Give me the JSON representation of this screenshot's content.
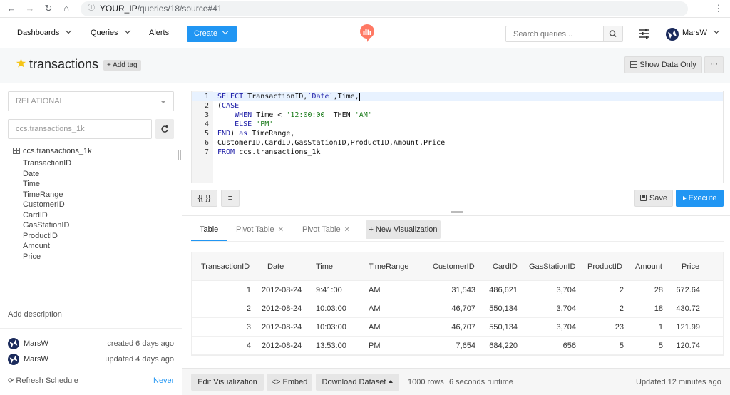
{
  "browser": {
    "url_host": "YOUR_IP",
    "url_path": "/queries/18/source#41"
  },
  "header": {
    "dashboards_label": "Dashboards",
    "queries_label": "Queries",
    "alerts_label": "Alerts",
    "create_label": "Create",
    "search_placeholder": "Search queries...",
    "user_name": "MarsW"
  },
  "query": {
    "title": "transactions",
    "add_tag_label": "+ Add tag",
    "show_data_label": "Show Data Only",
    "more_label": "···"
  },
  "schema": {
    "datasource": "RELATIONAL",
    "search_value": "ccs.transactions_1k",
    "table_name": "ccs.transactions_1k",
    "columns": [
      "TransactionID",
      "Date",
      "Time",
      "TimeRange",
      "CustomerID",
      "CardID",
      "GasStationID",
      "ProductID",
      "Amount",
      "Price"
    ],
    "add_description": "Add description",
    "created_by": "MarsW",
    "created_info": "created 6 days ago",
    "updated_by": "MarsW",
    "updated_info": "updated 4 days ago",
    "refresh_label": "Refresh Schedule",
    "refresh_value": "Never"
  },
  "editor": {
    "line_numbers": [
      "1",
      "2",
      "3",
      "4",
      "5",
      "6",
      "7"
    ],
    "l1_kw": "SELECT",
    "l1_a": " TransactionID,",
    "l1_tick": "`Date`",
    "l1_b": ",Time,",
    "l2_a": "(",
    "l2_kw": "CASE",
    "l3_indent": "    ",
    "l3_kw1": "WHEN",
    "l3_a": " Time < ",
    "l3_str": "'12:00:00'",
    "l3_b": " THEN ",
    "l3_str2": "'AM'",
    "l4_indent": "    ",
    "l4_kw": "ELSE",
    "l4_sp": " ",
    "l4_str": "'PM'",
    "l5_kw": "END",
    "l5_a": ") ",
    "l5_kw2": "as",
    "l5_b": " TimeRange,",
    "l6": "CustomerID,CardID,GasStationID,ProductID,Amount,Price",
    "l7_kw": "FROM",
    "l7_a": " ccs.transactions_1k",
    "params_label": "{{ }}",
    "format_label": "≡",
    "save_label": "Save",
    "execute_label": "Execute"
  },
  "tabs": [
    {
      "label": "Table"
    },
    {
      "label": "Pivot Table"
    },
    {
      "label": "Pivot Table"
    }
  ],
  "new_visualization_label": "+ New Visualization",
  "results": {
    "headers": [
      "TransactionID",
      "Date",
      "Time",
      "TimeRange",
      "CustomerID",
      "CardID",
      "GasStationID",
      "ProductID",
      "Amount",
      "Price"
    ],
    "rows": [
      [
        "1",
        "2012-08-24",
        "9:41:00",
        "AM",
        "31,543",
        "486,621",
        "3,704",
        "2",
        "28",
        "672.64"
      ],
      [
        "2",
        "2012-08-24",
        "10:03:00",
        "AM",
        "46,707",
        "550,134",
        "3,704",
        "2",
        "18",
        "430.72"
      ],
      [
        "3",
        "2012-08-24",
        "10:03:00",
        "AM",
        "46,707",
        "550,134",
        "3,704",
        "23",
        "1",
        "121.99"
      ],
      [
        "4",
        "2012-08-24",
        "13:53:00",
        "PM",
        "7,654",
        "684,220",
        "656",
        "5",
        "5",
        "120.74"
      ]
    ]
  },
  "bottom": {
    "edit_vis_label": "Edit Visualization",
    "embed_label": "<> Embed",
    "download_label": "Download Dataset",
    "rows_info": "1000 rows",
    "runtime_info": "6 seconds runtime",
    "updated_info": "Updated 12 minutes ago"
  },
  "colors": {
    "accent": "#2196f3",
    "logo": "#ff7964",
    "star": "#f5c518"
  }
}
